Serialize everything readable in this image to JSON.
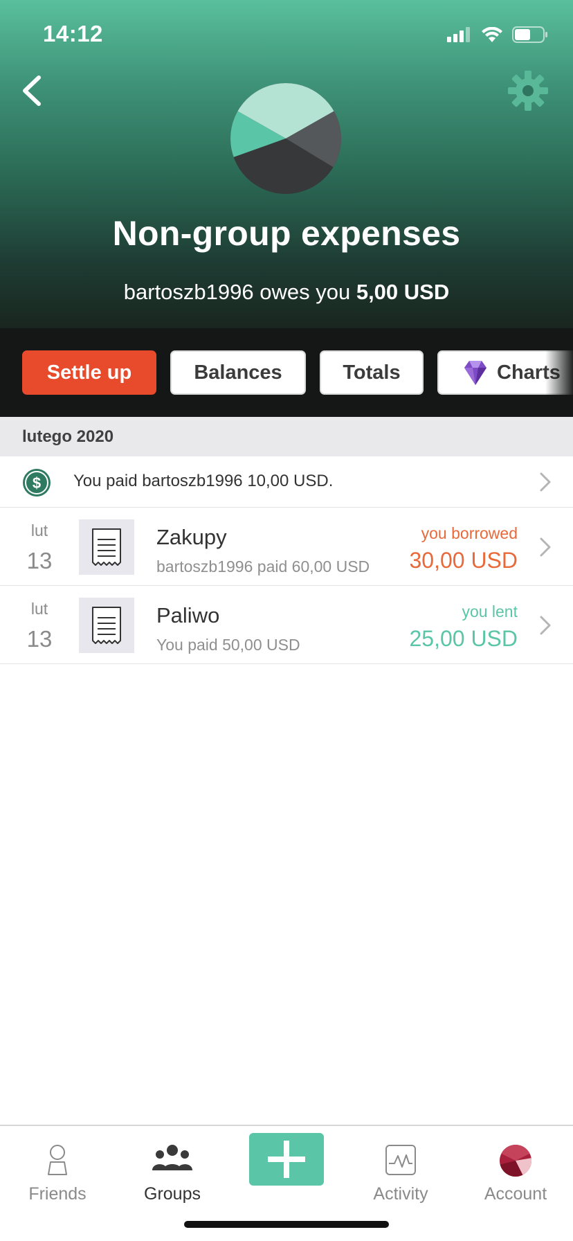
{
  "status_bar": {
    "time": "14:12"
  },
  "header": {
    "title": "Non-group expenses",
    "subtitle_prefix": "bartoszb1996 owes you ",
    "subtitle_amount": "5,00 USD"
  },
  "actions": {
    "settle_up": "Settle up",
    "balances": "Balances",
    "totals": "Totals",
    "charts": "Charts"
  },
  "month_section": {
    "label": "lutego 2020"
  },
  "payment": {
    "text": "You paid bartoszb1996 10,00 USD."
  },
  "expenses": [
    {
      "month": "lut",
      "day": "13",
      "title": "Zakupy",
      "subtitle": "bartoszb1996 paid 60,00 USD",
      "status": "you borrowed",
      "amount": "30,00 USD",
      "color": "#e8693a"
    },
    {
      "month": "lut",
      "day": "13",
      "title": "Paliwo",
      "subtitle": "You paid 50,00 USD",
      "status": "you lent",
      "amount": "25,00 USD",
      "color": "#5bc5a7"
    }
  ],
  "tabs": {
    "friends": "Friends",
    "groups": "Groups",
    "activity": "Activity",
    "account": "Account"
  },
  "colors": {
    "accent": "#5bc5a7",
    "settle": "#e84a2c",
    "borrowed": "#e8693a",
    "lent": "#5bc5a7"
  }
}
